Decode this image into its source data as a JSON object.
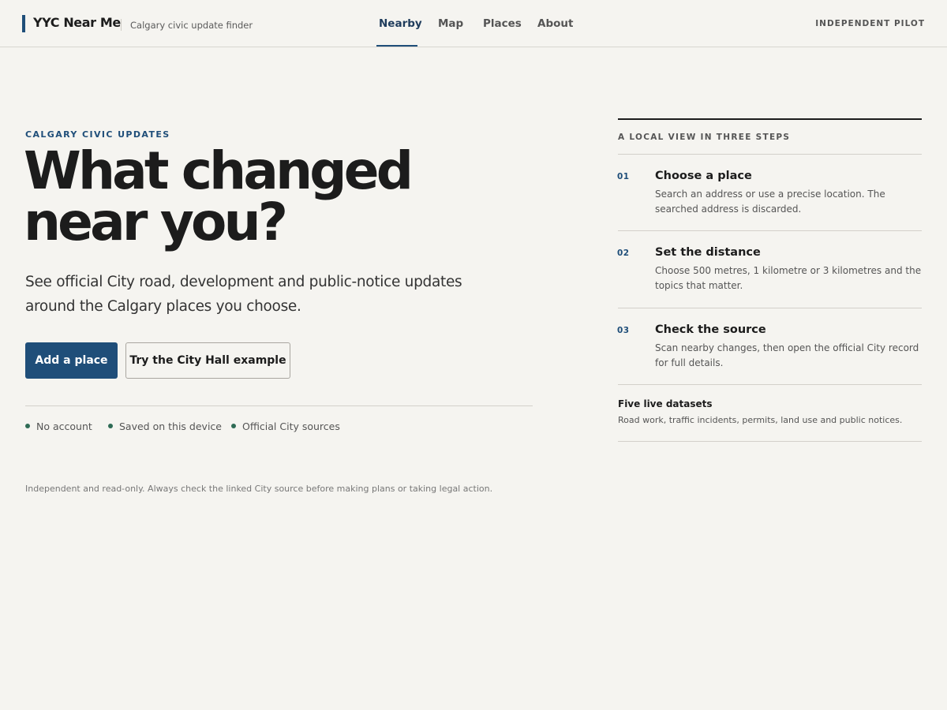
{
  "header": {
    "brand_name": "YYC Near Me",
    "brand_tagline": "Calgary civic update finder",
    "nav": [
      {
        "label": "Nearby",
        "active": true
      },
      {
        "label": "Map",
        "active": false
      },
      {
        "label": "Places",
        "active": false
      },
      {
        "label": "About",
        "active": false
      }
    ],
    "badge": "INDEPENDENT PILOT"
  },
  "hero": {
    "eyebrow": "CALGARY CIVIC UPDATES",
    "headline_line1": "What changed",
    "headline_line2": "near you?",
    "lede": "See official City road, development and public-notice updates around the Calgary places you choose.",
    "primary_button": "Add a place",
    "secondary_button": "Try the City Hall example",
    "features": [
      "No account",
      "Saved on this device",
      "Official City sources"
    ],
    "disclaimer": "Independent and read-only. Always check the linked City source before making plans or taking legal action."
  },
  "steps_panel": {
    "label": "A LOCAL VIEW IN THREE STEPS",
    "steps": [
      {
        "number": "01",
        "title": "Choose a place",
        "description": "Search an address or use a precise location. The searched address is discarded."
      },
      {
        "number": "02",
        "title": "Set the distance",
        "description": "Choose 500 metres, 1 kilometre or 3 kilometres and the topics that matter."
      },
      {
        "number": "03",
        "title": "Check the source",
        "description": "Scan nearby changes, then open the official City record for full details."
      }
    ],
    "datasets_title": "Five live datasets",
    "datasets_description": "Road work, traffic incidents, permits, land use and public notices."
  },
  "colors": {
    "background": "#f5f4f0",
    "accent": "#1f4e79",
    "feature_dot": "#2e6b55"
  }
}
